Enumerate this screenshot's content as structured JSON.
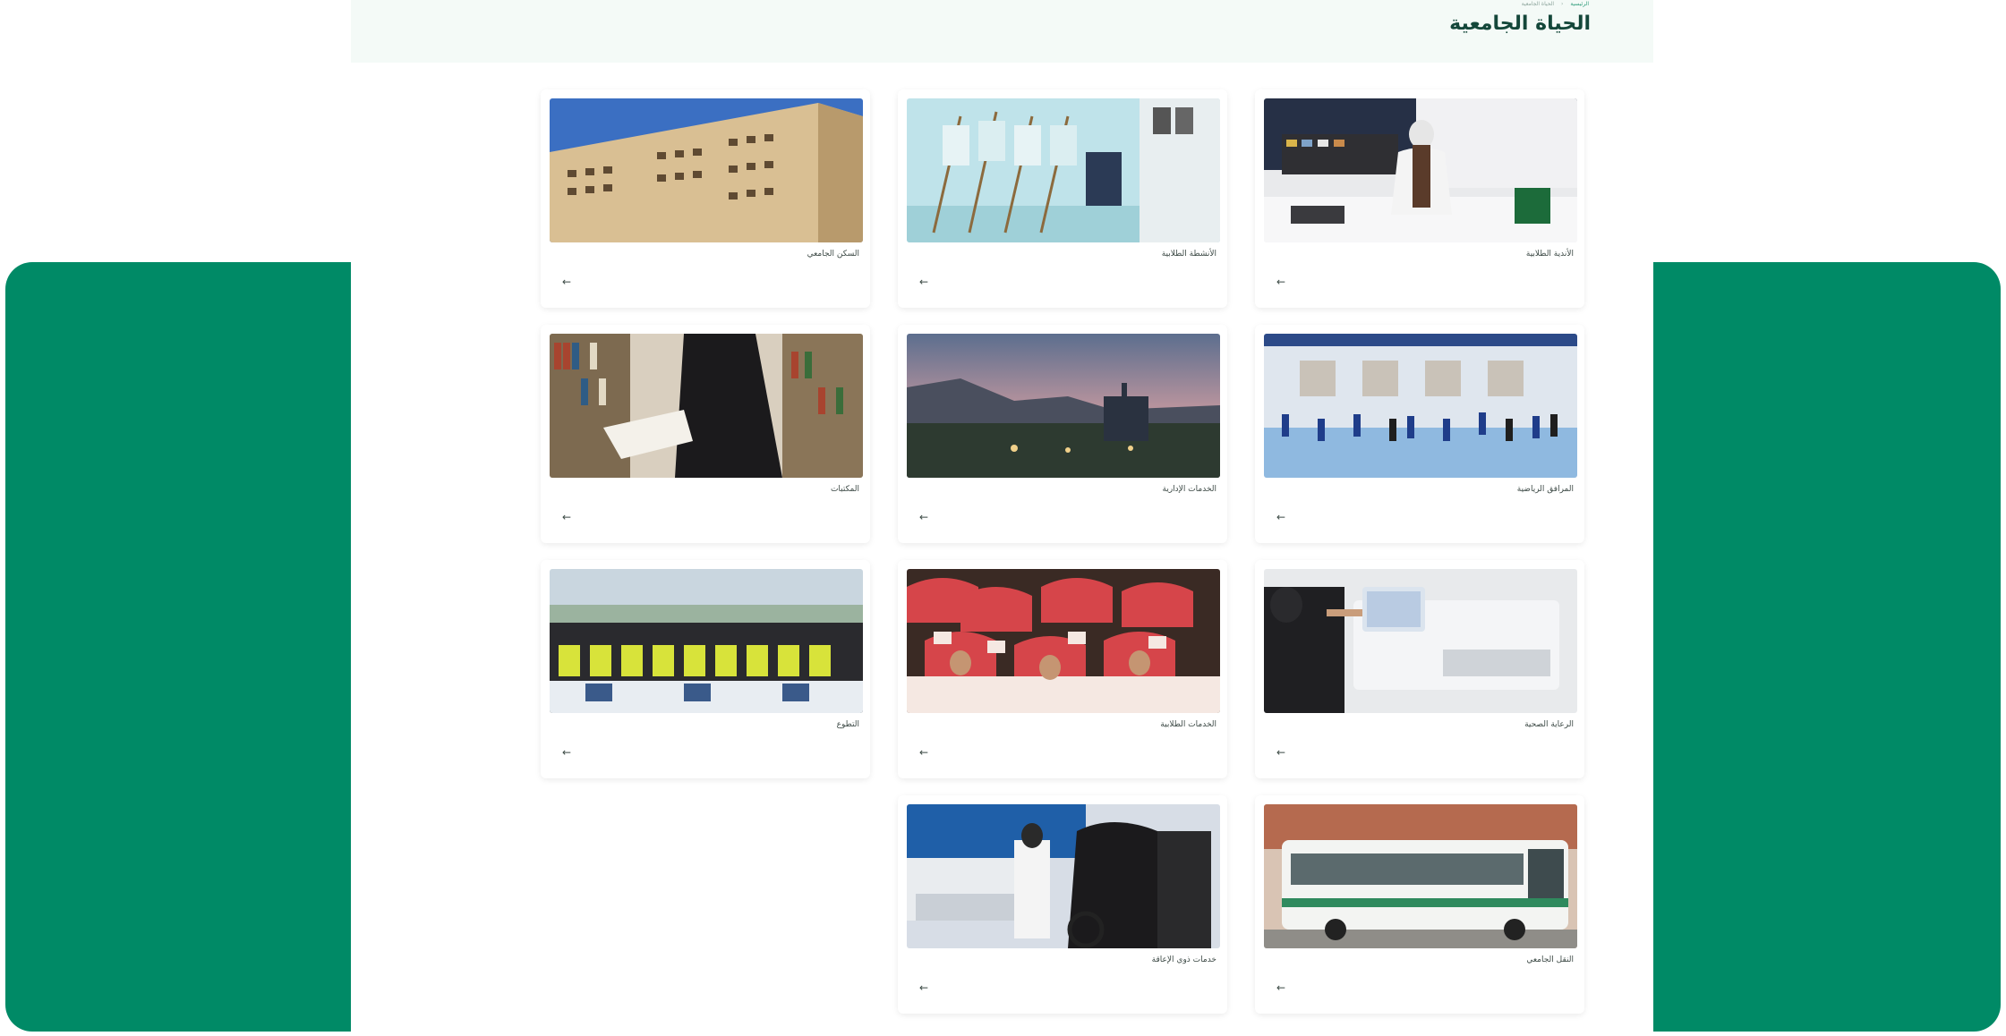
{
  "header": {
    "title": "الحياة الجامعية",
    "breadcrumb": [
      "الرئيسية",
      "الحياة الجامعية"
    ],
    "breadcrumb_sep": "‹"
  },
  "cards": [
    {
      "label": "الأندية الطلابية",
      "arrow": "←"
    },
    {
      "label": "الأنشطة الطلابية",
      "arrow": "←"
    },
    {
      "label": "السكن الجامعي",
      "arrow": "←"
    },
    {
      "label": "المرافق الرياضية",
      "arrow": "←"
    },
    {
      "label": "الخدمات الإدارية",
      "arrow": "←"
    },
    {
      "label": "المكتبات",
      "arrow": "←"
    },
    {
      "label": "الرعاية الصحية",
      "arrow": "←"
    },
    {
      "label": "الخدمات الطلابية",
      "arrow": "←"
    },
    {
      "label": "التطوع",
      "arrow": "←"
    },
    {
      "label": "النقل الجامعي",
      "arrow": "←"
    },
    {
      "label": "خدمات ذوي الإعاقة",
      "arrow": "←"
    }
  ],
  "colors": {
    "brand_green": "#008a66",
    "header_bg": "#f4faf7",
    "title": "#14473a"
  }
}
